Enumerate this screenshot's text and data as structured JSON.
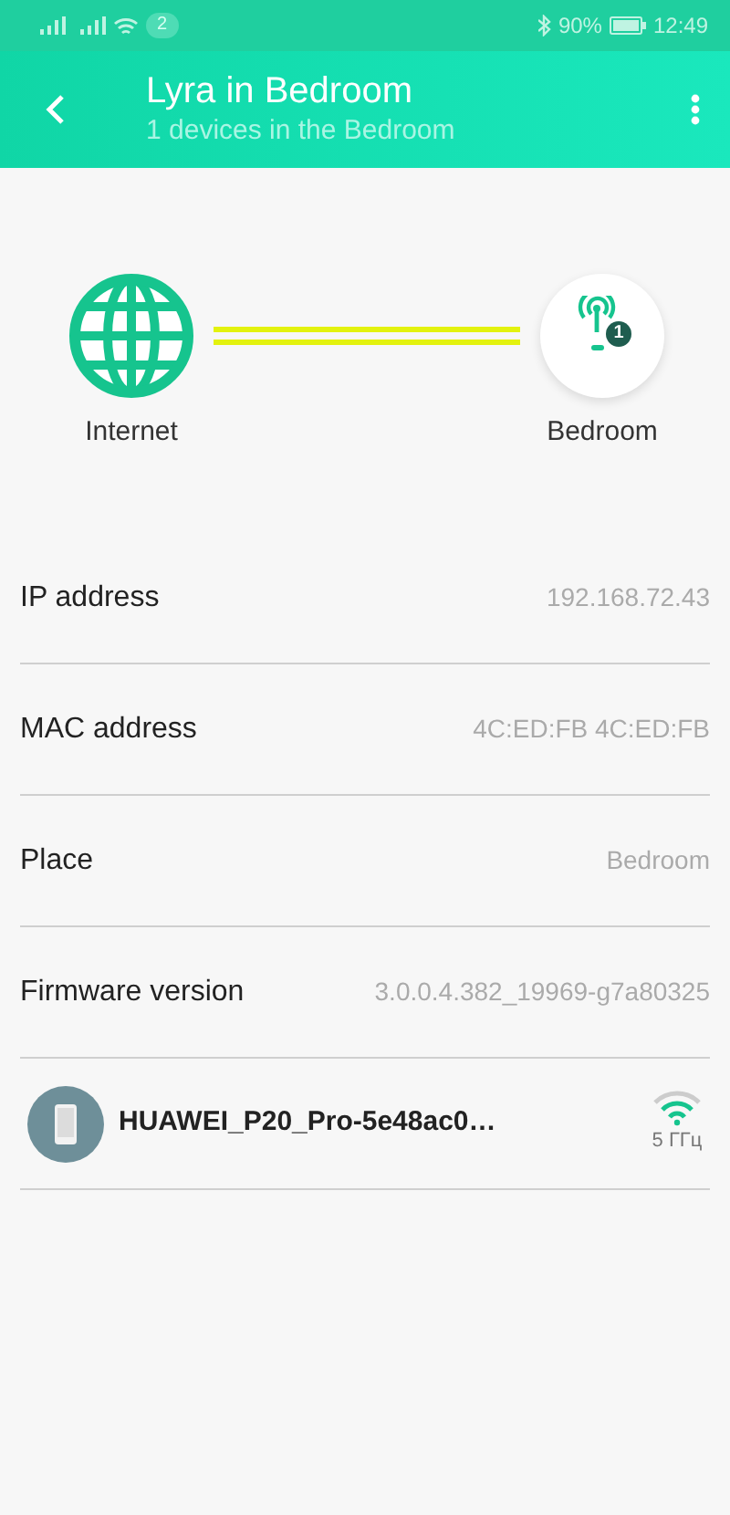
{
  "status_bar": {
    "notification_count": "2",
    "battery": "90%",
    "time": "12:49"
  },
  "header": {
    "title": "Lyra in Bedroom",
    "subtitle": "1 devices in the Bedroom"
  },
  "topology": {
    "source_label": "Internet",
    "node_label": "Bedroom",
    "node_badge": "1"
  },
  "details": [
    {
      "label": "IP address",
      "value": "192.168.72.43"
    },
    {
      "label": "MAC address",
      "value": "4C:ED:FB 4C:ED:FB"
    },
    {
      "label": "Place",
      "value": "Bedroom"
    },
    {
      "label": "Firmware version",
      "value": "3.0.0.4.382_19969-g7a80325"
    }
  ],
  "devices": [
    {
      "name": "HUAWEI_P20_Pro-5e48ac0…",
      "band": "5 ГГц"
    }
  ]
}
